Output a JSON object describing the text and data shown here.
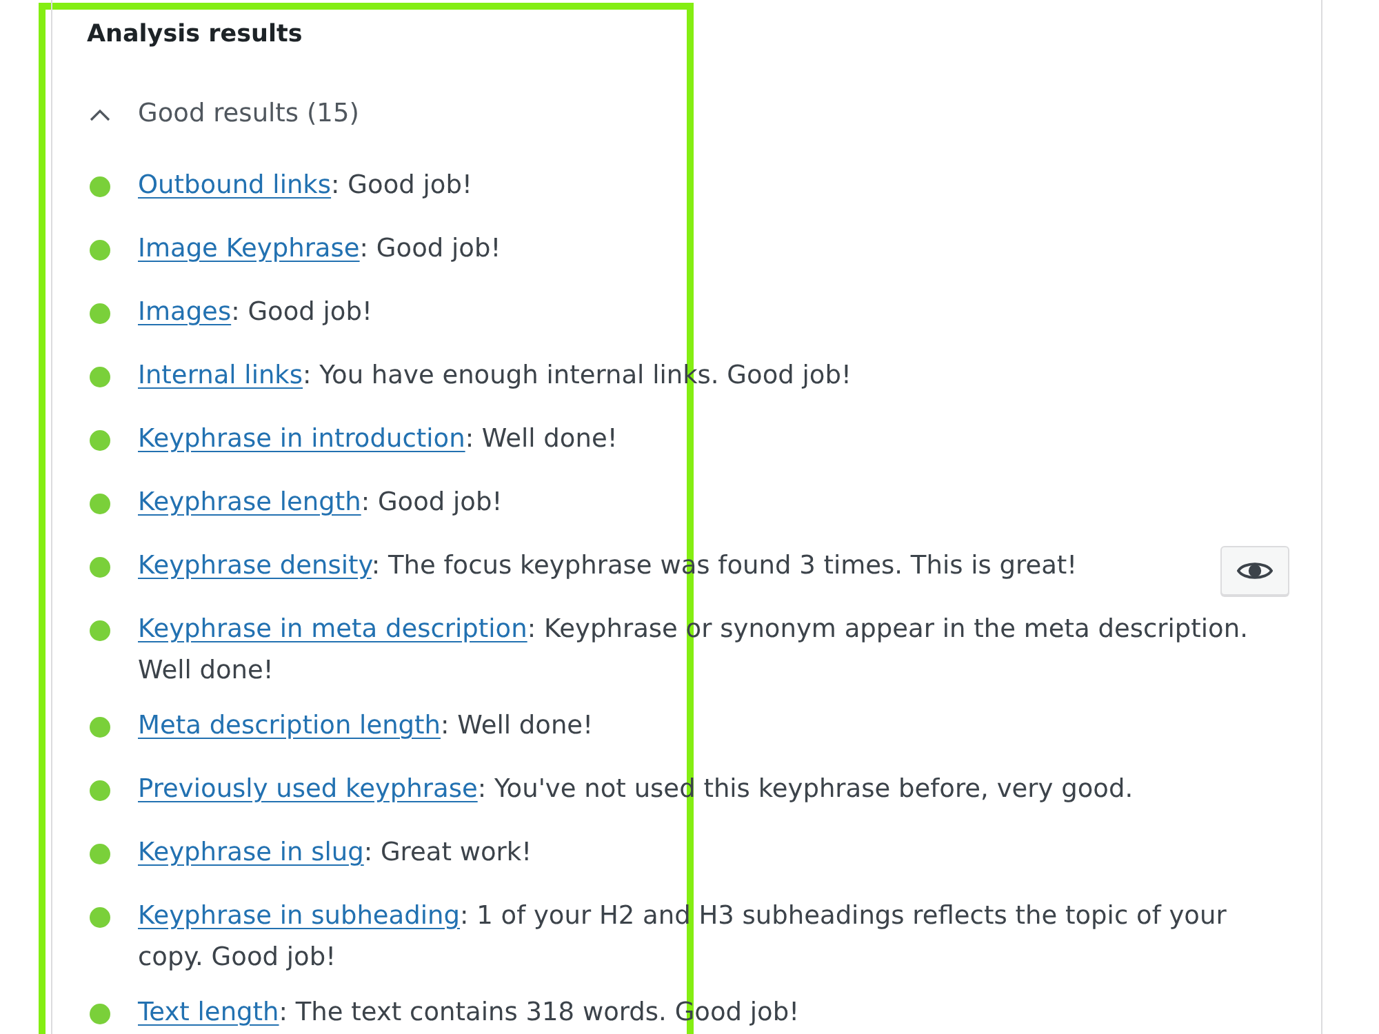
{
  "heading": "Analysis results",
  "highlight": true,
  "results_group": {
    "label": "Good results (15)",
    "expanded": true,
    "items": [
      {
        "link": "Outbound links",
        "text": ": Good job!",
        "color": "#7ad03a",
        "marker_button": false
      },
      {
        "link": "Image Keyphrase",
        "text": ": Good job!",
        "color": "#7ad03a",
        "marker_button": false
      },
      {
        "link": "Images",
        "text": ": Good job!",
        "color": "#7ad03a",
        "marker_button": false
      },
      {
        "link": "Internal links",
        "text": ": You have enough internal links. Good job!",
        "color": "#7ad03a",
        "marker_button": false
      },
      {
        "link": "Keyphrase in introduction",
        "text": ": Well done!",
        "color": "#7ad03a",
        "marker_button": false
      },
      {
        "link": "Keyphrase length",
        "text": ": Good job!",
        "color": "#7ad03a",
        "marker_button": false
      },
      {
        "link": "Keyphrase density",
        "text": ": The focus keyphrase was found 3 times. This is great!",
        "color": "#7ad03a",
        "marker_button": true
      },
      {
        "link": "Keyphrase in meta description",
        "text": ": Keyphrase or synonym appear in the meta description. Well done!",
        "color": "#7ad03a",
        "marker_button": false
      },
      {
        "link": "Meta description length",
        "text": ": Well done!",
        "color": "#7ad03a",
        "marker_button": false
      },
      {
        "link": "Previously used keyphrase",
        "text": ": You've not used this keyphrase before, very good.",
        "color": "#7ad03a",
        "marker_button": false
      },
      {
        "link": "Keyphrase in slug",
        "text": ": Great work!",
        "color": "#7ad03a",
        "marker_button": false
      },
      {
        "link": "Keyphrase in subheading",
        "text": ": 1 of your H2 and H3 subheadings reflects the topic of your copy. Good job!",
        "color": "#7ad03a",
        "marker_button": false
      },
      {
        "link": "Text length",
        "text": ": The text contains 318 words. Good job!",
        "color": "#7ad03a",
        "marker_button": false
      }
    ]
  }
}
